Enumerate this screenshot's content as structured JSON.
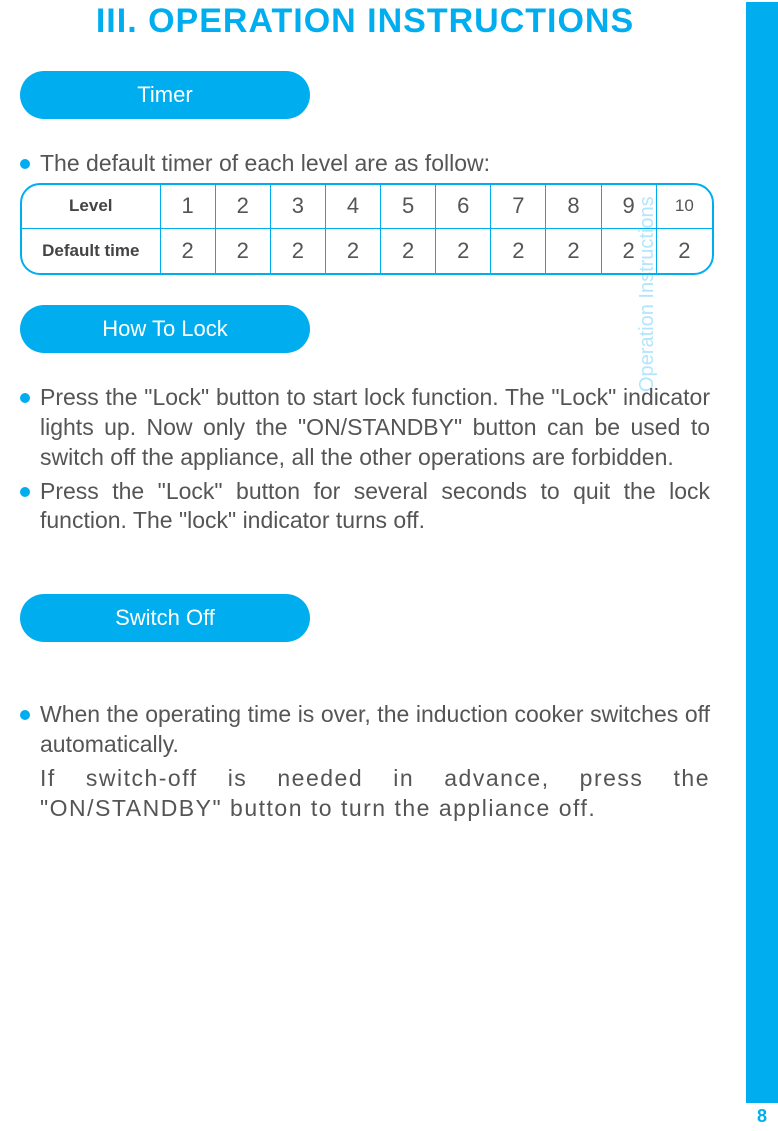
{
  "title": "III. OPERATION INSTRUCTIONS",
  "sidebar": {
    "label": "Operation Instructions",
    "page_number": "8"
  },
  "timer": {
    "heading": "Timer",
    "intro": "The default timer of each level are as follow:",
    "row_label_level": "Level",
    "row_label_default": "Default time",
    "levels": [
      "1",
      "2",
      "3",
      "4",
      "5",
      "6",
      "7",
      "8",
      "9",
      "10"
    ],
    "default_times": [
      "2",
      "2",
      "2",
      "2",
      "2",
      "2",
      "2",
      "2",
      "2",
      "2"
    ]
  },
  "lock": {
    "heading": "How To Lock",
    "items": [
      "Press the \"Lock\" button to start lock function. The \"Lock\" indicator lights up. Now only the \"ON/STANDBY\" button can be used to switch off the appliance, all the other operations are forbidden.",
      "Press the \"Lock\" button for several seconds to quit the lock function. The \"lock\" indicator turns off."
    ]
  },
  "switchoff": {
    "heading": "Switch Off",
    "item1": "When the operating time is over, the induction cooker switches off automatically.",
    "item1b": "If switch-off is needed in advance, press the \"ON/STANDBY\" button to turn the appliance off."
  }
}
